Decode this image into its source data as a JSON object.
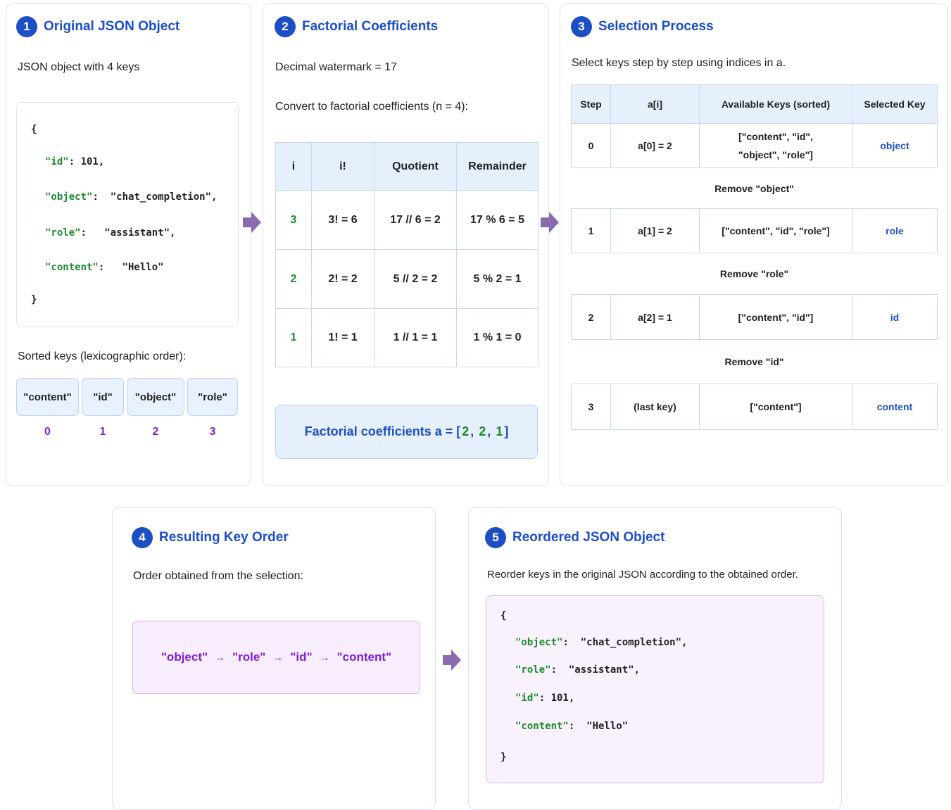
{
  "panel1": {
    "num": "1",
    "title": "Original JSON Object",
    "subtitle": "JSON object with 4 keys",
    "code": {
      "open": "{",
      "lines": [
        {
          "key": "\"id\"",
          "rest": ": 101,"
        },
        {
          "key": "\"object\"",
          "rest": ":  \"chat_completion\","
        },
        {
          "key": "\"role\"",
          "rest": ":   \"assistant\","
        },
        {
          "key": "\"content\"",
          "rest": ":   \"Hello\""
        }
      ],
      "close": "}"
    },
    "sorted_label": "Sorted keys (lexicographic order):",
    "sorted_keys": [
      "\"content\"",
      "\"id\"",
      "\"object\"",
      "\"role\""
    ],
    "indices": [
      "0",
      "1",
      "2",
      "3"
    ]
  },
  "panel2": {
    "num": "2",
    "title": "Factorial Coefficients",
    "watermark": "Decimal watermark = 17",
    "convert": "Convert to factorial coefficients (n = 4):",
    "headers": [
      "i",
      "i!",
      "Quotient",
      "Remainder"
    ],
    "rows": [
      [
        "3",
        "3! = 6",
        "17 // 6 = 2",
        "17 % 6 = 5"
      ],
      [
        "2",
        "2! = 2",
        "5 // 2 = 2",
        "5 % 2 = 1"
      ],
      [
        "1",
        "1! = 1",
        "1 // 1 = 1",
        "1 % 1 = 0"
      ]
    ],
    "result_prefix": "Factorial coefficients a = [",
    "result_values": [
      "2",
      "2",
      "1"
    ],
    "result_sep": ", ",
    "result_suffix": "]"
  },
  "panel3": {
    "num": "3",
    "title": "Selection Process",
    "subtitle": "Select keys step by step using indices in a.",
    "headers": [
      "Step",
      "a[i]",
      "Available Keys (sorted)",
      "Selected Key"
    ],
    "steps": [
      {
        "step": "0",
        "ai": "a[0] = 2",
        "available_1": "[\"content\", \"id\",",
        "available_2": "\"object\", \"role\"]",
        "selected": "object",
        "remove": "Remove \"object\""
      },
      {
        "step": "1",
        "ai": "a[1] = 2",
        "available_1": "[\"content\", \"id\", \"role\"]",
        "available_2": "",
        "selected": "role",
        "remove": "Remove \"role\""
      },
      {
        "step": "2",
        "ai": "a[2] = 1",
        "available_1": "[\"content\", \"id\"]",
        "available_2": "",
        "selected": "id",
        "remove": "Remove \"id\""
      },
      {
        "step": "3",
        "ai": "(last key)",
        "available_1": "[\"content\"]",
        "available_2": "",
        "selected": "content",
        "remove": ""
      }
    ]
  },
  "panel4": {
    "num": "4",
    "title": "Resulting Key Order",
    "subtitle": "Order obtained from the selection:",
    "order": [
      "\"object\"",
      "\"role\"",
      "\"id\"",
      "\"content\""
    ],
    "arrow": "→"
  },
  "panel5": {
    "num": "5",
    "title": "Reordered JSON Object",
    "subtitle": "Reorder keys in the original JSON according to the obtained order.",
    "code": {
      "open": "{",
      "lines": [
        {
          "key": "\"object\"",
          "rest": ":  \"chat_completion\","
        },
        {
          "key": "\"role\"",
          "rest": ":  \"assistant\","
        },
        {
          "key": "\"id\"",
          "rest": ": 101,"
        },
        {
          "key": "\"content\"",
          "rest": ":  \"Hello\""
        }
      ],
      "close": "}"
    }
  },
  "colors": {
    "accent": "#1d4fc4",
    "key_green": "#1b8a2b",
    "index_purple": "#7b1fd6",
    "arrow": "#8a6bb0",
    "table_header": "#e6f0fc"
  }
}
